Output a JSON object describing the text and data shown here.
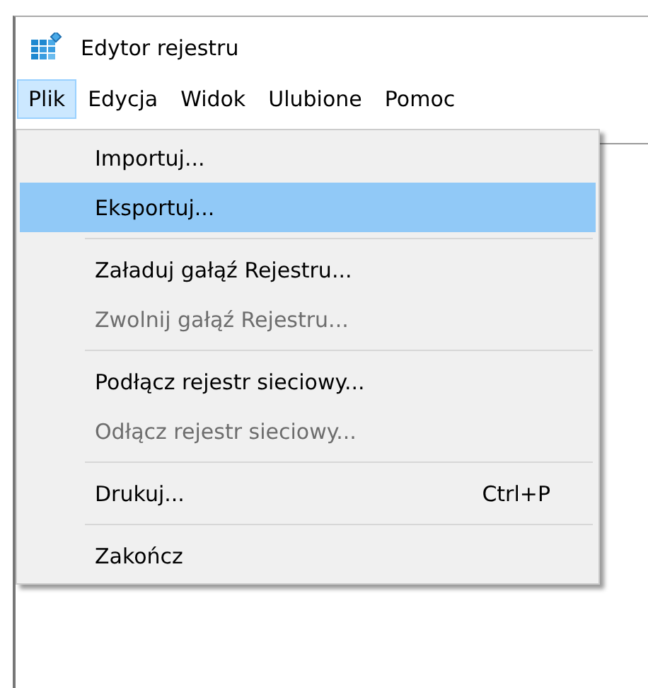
{
  "window": {
    "title": "Edytor rejestru"
  },
  "menubar": [
    {
      "label": "Plik",
      "selected": true
    },
    {
      "label": "Edycja",
      "selected": false
    },
    {
      "label": "Widok",
      "selected": false
    },
    {
      "label": "Ulubione",
      "selected": false
    },
    {
      "label": "Pomoc",
      "selected": false
    }
  ],
  "menu": [
    {
      "kind": "item",
      "label": "Importuj...",
      "selected": false,
      "disabled": false
    },
    {
      "kind": "item",
      "label": "Eksportuj...",
      "selected": true,
      "disabled": false
    },
    {
      "kind": "separator"
    },
    {
      "kind": "item",
      "label": "Załaduj gałąź Rejestru...",
      "selected": false,
      "disabled": false
    },
    {
      "kind": "item",
      "label": "Zwolnij gałąź Rejestru...",
      "selected": false,
      "disabled": true
    },
    {
      "kind": "separator"
    },
    {
      "kind": "item",
      "label": "Podłącz rejestr sieciowy...",
      "selected": false,
      "disabled": false
    },
    {
      "kind": "item",
      "label": "Odłącz rejestr sieciowy...",
      "selected": false,
      "disabled": true
    },
    {
      "kind": "separator"
    },
    {
      "kind": "item",
      "label": "Drukuj...",
      "shortcut": "Ctrl+P",
      "selected": false,
      "disabled": false
    },
    {
      "kind": "separator"
    },
    {
      "kind": "item",
      "label": "Zakończ",
      "selected": false,
      "disabled": false
    }
  ]
}
